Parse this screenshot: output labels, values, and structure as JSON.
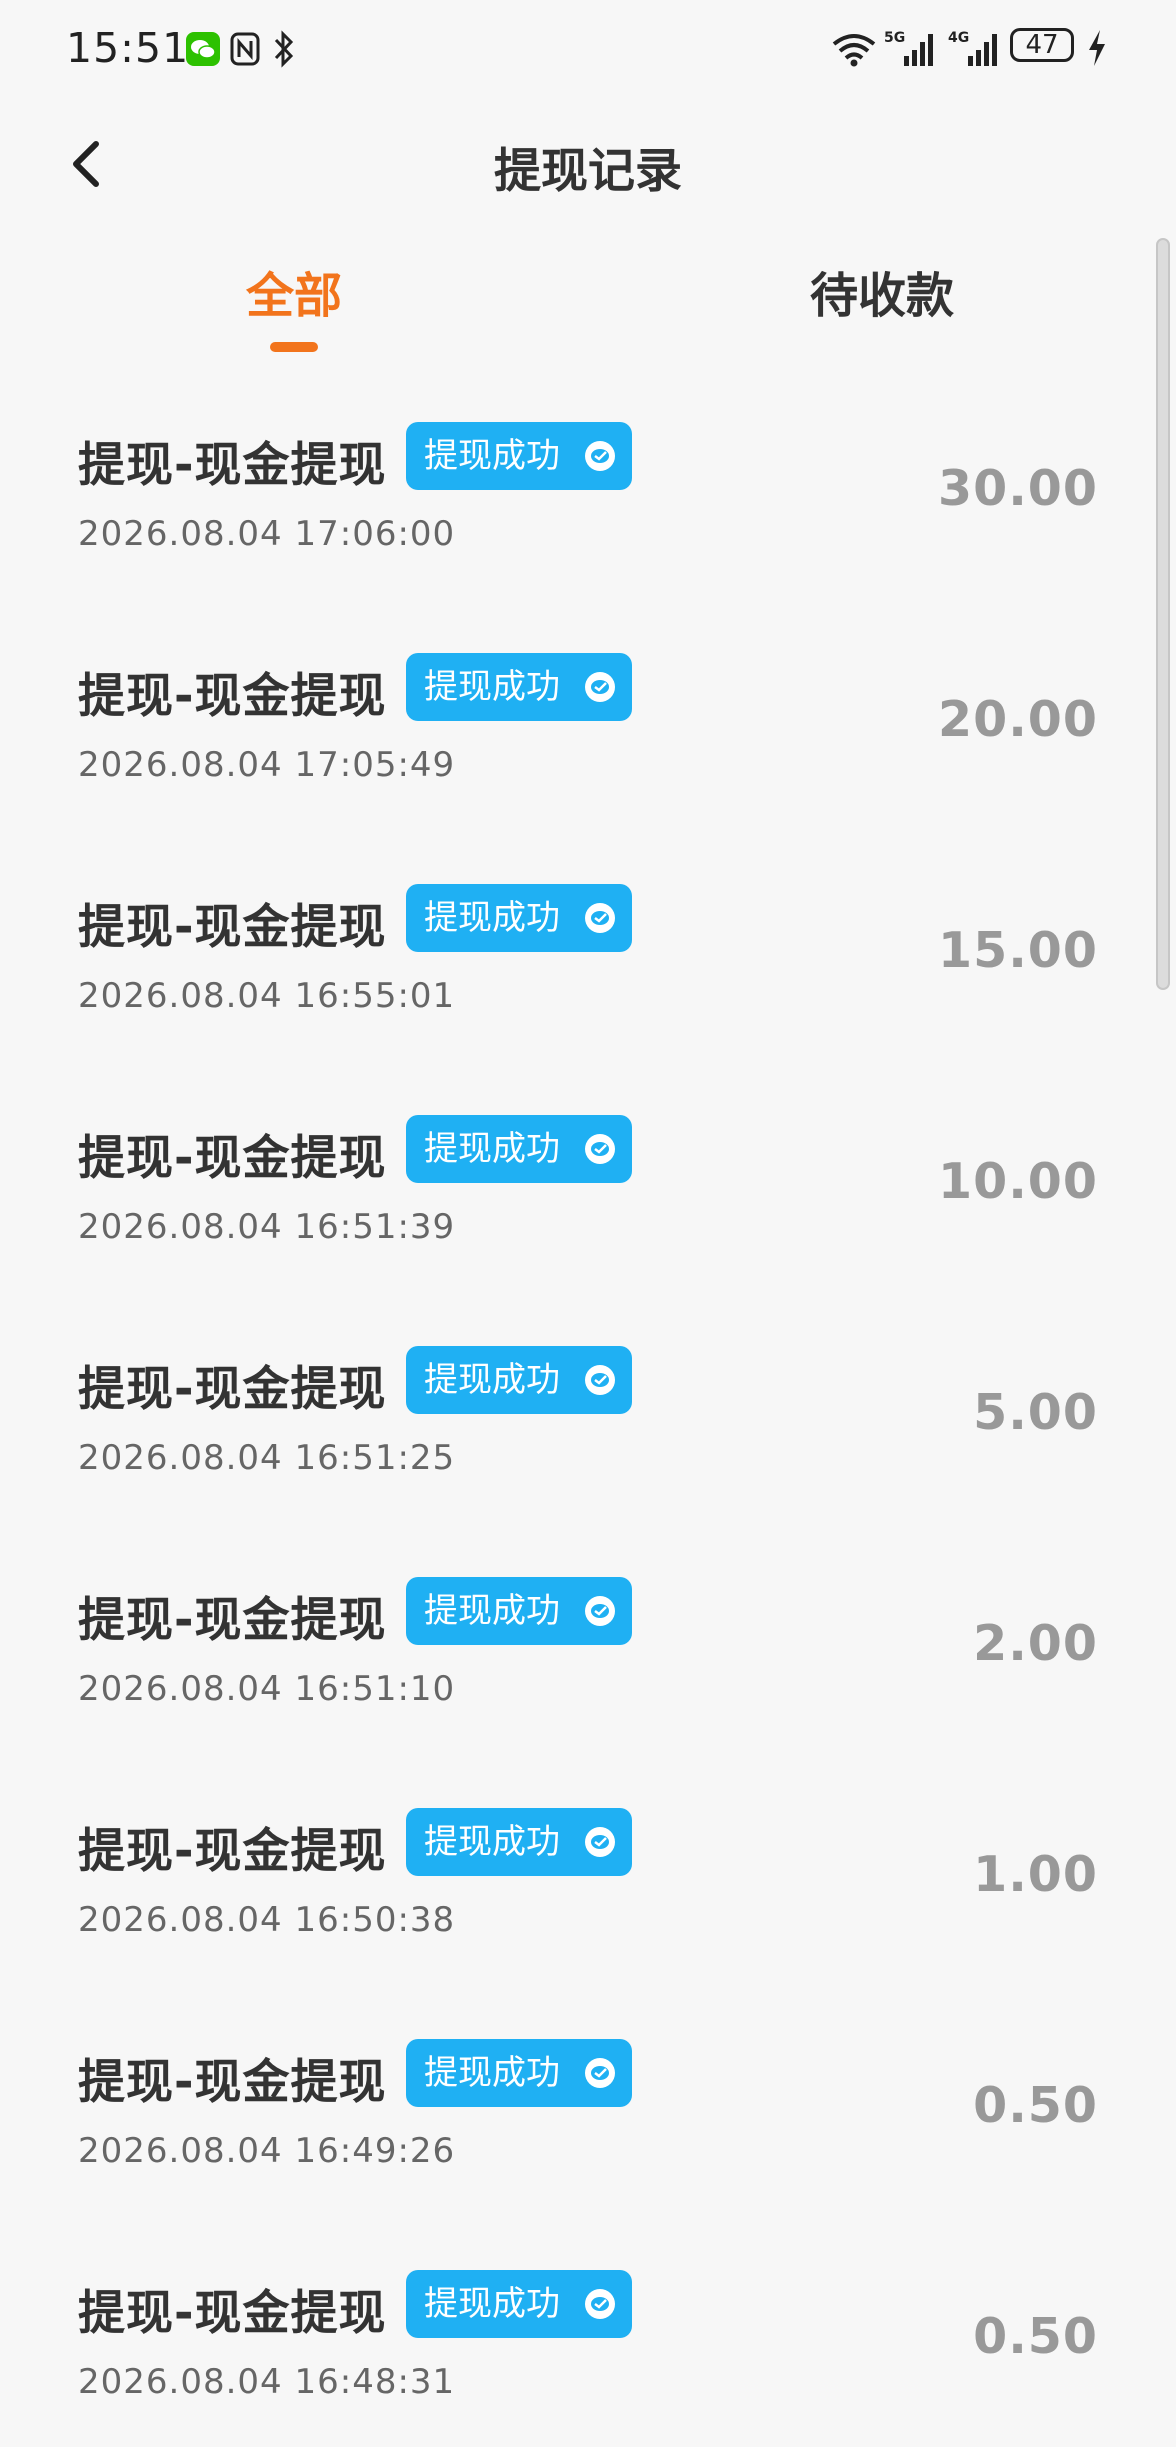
{
  "status_bar": {
    "time": "15:51",
    "battery": "47",
    "icons": [
      "wechat-icon",
      "nfc-icon",
      "bluetooth-icon",
      "wifi-icon",
      "signal-5g-icon",
      "signal-4g-icon",
      "battery-icon",
      "charging-icon"
    ]
  },
  "header": {
    "title": "提现记录"
  },
  "tabs": [
    {
      "label": "全部",
      "active": true
    },
    {
      "label": "待收款",
      "active": false
    }
  ],
  "records": [
    {
      "title": "提现-现金提现",
      "status": "提现成功",
      "time": "2026.08.04 17:06:00",
      "amount": "30.00"
    },
    {
      "title": "提现-现金提现",
      "status": "提现成功",
      "time": "2026.08.04 17:05:49",
      "amount": "20.00"
    },
    {
      "title": "提现-现金提现",
      "status": "提现成功",
      "time": "2026.08.04 16:55:01",
      "amount": "15.00"
    },
    {
      "title": "提现-现金提现",
      "status": "提现成功",
      "time": "2026.08.04 16:51:39",
      "amount": "10.00"
    },
    {
      "title": "提现-现金提现",
      "status": "提现成功",
      "time": "2026.08.04 16:51:25",
      "amount": "5.00"
    },
    {
      "title": "提现-现金提现",
      "status": "提现成功",
      "time": "2026.08.04 16:51:10",
      "amount": "2.00"
    },
    {
      "title": "提现-现金提现",
      "status": "提现成功",
      "time": "2026.08.04 16:50:38",
      "amount": "1.00"
    },
    {
      "title": "提现-现金提现",
      "status": "提现成功",
      "time": "2026.08.04 16:49:26",
      "amount": "0.50"
    },
    {
      "title": "提现-现金提现",
      "status": "提现成功",
      "time": "2026.08.04 16:48:31",
      "amount": "0.50"
    }
  ],
  "colors": {
    "accent": "#f2741c",
    "badge": "#1fb0f3",
    "amount": "#999999",
    "background": "#f7f7f7"
  }
}
